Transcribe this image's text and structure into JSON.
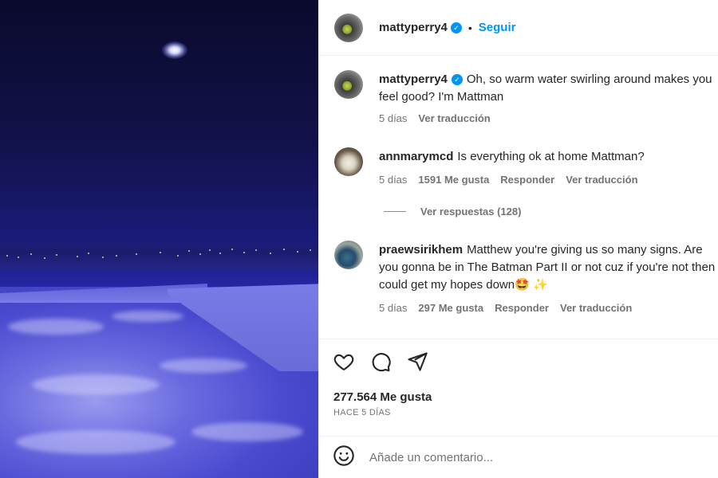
{
  "post": {
    "username": "mattyperry4",
    "separator": "•",
    "follow_label": "Seguir"
  },
  "caption": {
    "username": "mattyperry4",
    "text": "Oh, so warm water swirling around makes you feel good? I'm Mattman",
    "time": "5 días",
    "translate": "Ver traducción"
  },
  "comments": [
    {
      "username": "annmarymcd",
      "text": "Is everything ok at home Mattman?",
      "time": "5 días",
      "likes": "1591 Me gusta",
      "reply": "Responder",
      "translate": "Ver traducción"
    },
    {
      "username": "praewsirikhem",
      "text": "Matthew you're giving us so many signs. Are you gonna be in The Batman Part II or not cuz if you're not then i could get my hopes down🤩 ✨",
      "time": "5 días",
      "likes": "297 Me gusta",
      "reply": "Responder",
      "translate": "Ver traducción"
    }
  ],
  "view_replies": "Ver respuestas (128)",
  "actions": {
    "like_icon": "heart-icon",
    "comment_icon": "comment-icon",
    "share_icon": "share-icon"
  },
  "likes_count": "277.564 Me gusta",
  "time_ago": "HACE 5 DÍAS",
  "add_comment": {
    "emoji_icon": "emoji-icon",
    "placeholder": "Añade un comentario..."
  },
  "colors": {
    "accent": "#0095f6",
    "text": "#262626",
    "muted": "#737373"
  }
}
